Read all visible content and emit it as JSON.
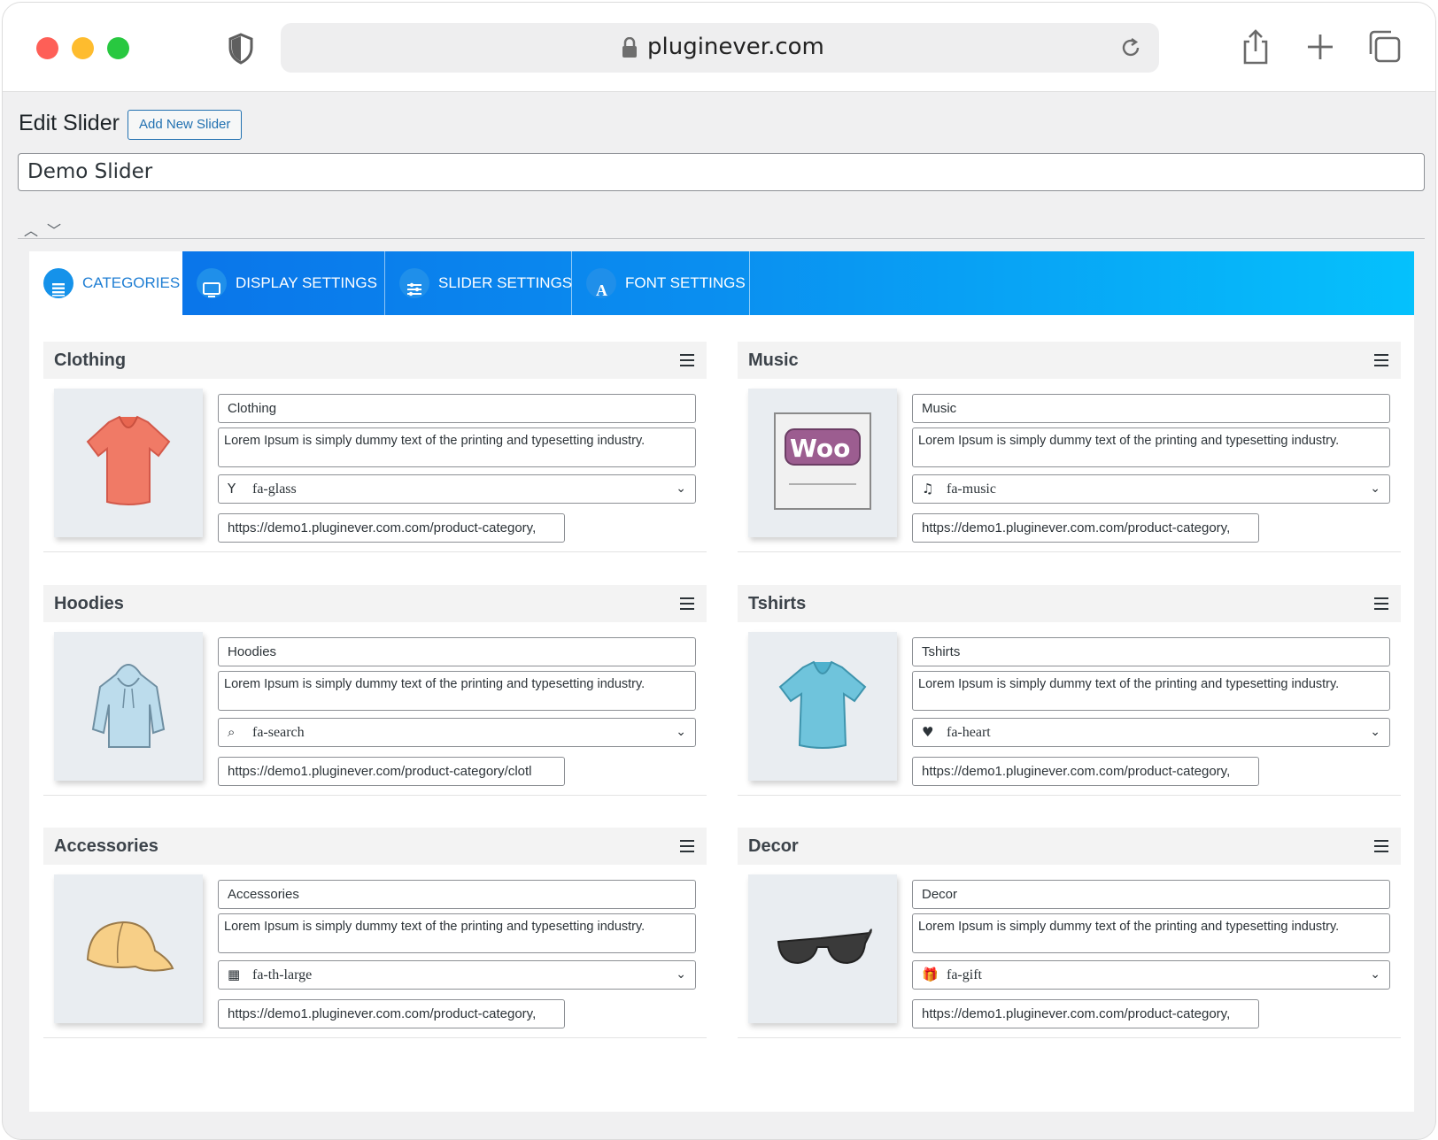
{
  "browser": {
    "url": "pluginever.com"
  },
  "page": {
    "title": "Edit Slider",
    "add_new_label": "Add New Slider",
    "slider_name": "Demo Slider"
  },
  "tabs": [
    {
      "label": "CATEGORIES",
      "icon": "list-icon",
      "active": true
    },
    {
      "label": "DISPLAY SETTINGS",
      "icon": "monitor-icon",
      "active": false
    },
    {
      "label": "SLIDER SETTINGS",
      "icon": "sliders-icon",
      "active": false
    },
    {
      "label": "FONT SETTINGS",
      "icon": "font-icon",
      "active": false
    }
  ],
  "categories": [
    {
      "title": "Clothing",
      "name": "Clothing",
      "description": "Lorem Ipsum is simply dummy text of the printing and typesetting industry.",
      "icon_glyph": "Y",
      "icon_name": "fa-glass",
      "url": "https://demo1.pluginever.com.com/product-category,",
      "image": "red-tshirt"
    },
    {
      "title": "Music",
      "name": "Music",
      "description": "Lorem Ipsum is simply dummy text of the printing and typesetting industry.",
      "icon_glyph": "♫",
      "icon_name": "fa-music",
      "url": "https://demo1.pluginever.com.com/product-category,",
      "image": "woo-album"
    },
    {
      "title": "Hoodies",
      "name": "Hoodies",
      "description": "Lorem Ipsum is simply dummy text of the printing and typesetting industry.",
      "icon_glyph": "⌕",
      "icon_name": "fa-search",
      "url": "https://demo1.pluginever.com/product-category/clotl",
      "image": "blue-hoodie"
    },
    {
      "title": "Tshirts",
      "name": "Tshirts",
      "description": "Lorem Ipsum is simply dummy text of the printing and typesetting industry.",
      "icon_glyph": "♥",
      "icon_name": "fa-heart",
      "url": "https://demo1.pluginever.com.com/product-category,",
      "image": "blue-tshirt"
    },
    {
      "title": "Accessories",
      "name": "Accessories",
      "description": "Lorem Ipsum is simply dummy text of the printing and typesetting industry.",
      "icon_glyph": "▦",
      "icon_name": "fa-th-large",
      "url": "https://demo1.pluginever.com.com/product-category,",
      "image": "cap"
    },
    {
      "title": "Decor",
      "name": "Decor",
      "description": "Lorem Ipsum is simply dummy text of the printing and typesetting industry.",
      "icon_glyph": "🎁",
      "icon_name": "fa-gift",
      "url": "https://demo1.pluginever.com.com/product-category,",
      "image": "sunglasses"
    }
  ],
  "colors": {
    "tab_start": "#0a6ee8",
    "tab_end": "#05c1fc",
    "accent": "#2271b1"
  }
}
